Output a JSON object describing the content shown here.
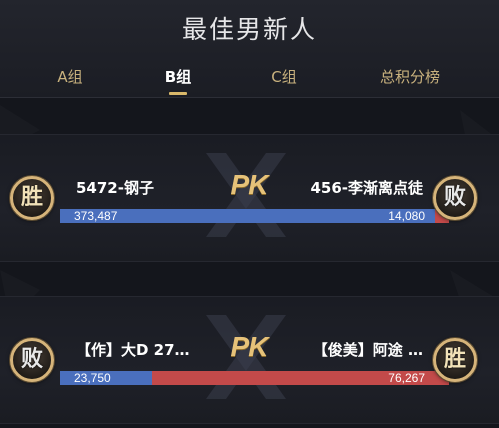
{
  "header": {
    "title": "最佳男新人"
  },
  "tabs": [
    {
      "label": "A组",
      "active": false
    },
    {
      "label": "B组",
      "active": true
    },
    {
      "label": "C组",
      "active": false
    },
    {
      "label": "总积分榜",
      "active": false
    }
  ],
  "pk_label": "PK",
  "matches": [
    {
      "left": {
        "name": "5472-钢子",
        "score": "373,487",
        "result": "胜"
      },
      "right": {
        "name": "456-李渐离点徒",
        "score": "14,080",
        "result": "败"
      },
      "left_share": 0.964
    },
    {
      "left": {
        "name": "【作】大D 27…",
        "score": "23,750",
        "result": "败"
      },
      "right": {
        "name": "【俊美】阿途 …",
        "score": "76,267",
        "result": "胜"
      },
      "left_share": 0.237
    }
  ],
  "colors": {
    "left_bar": "#4a6fbd",
    "right_bar": "#c34a4a",
    "accent_gold": "#d9b86a",
    "background": "#14161c"
  }
}
